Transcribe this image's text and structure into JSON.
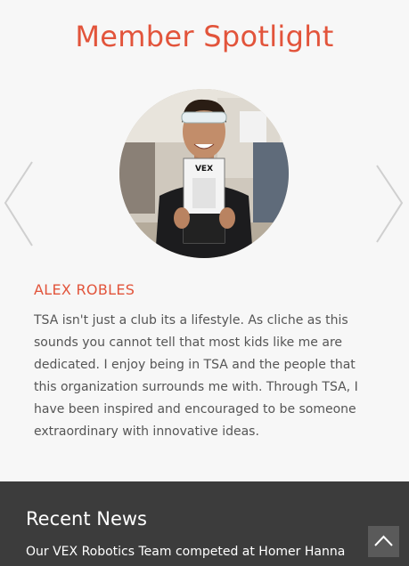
{
  "spotlight": {
    "title": "Member Spotlight",
    "photo_badge_text": "VEX",
    "member": {
      "name": "ALEX ROBLES",
      "quote": "TSA isn't just a club its a lifestyle. As cliche as this sounds you cannot tell that most kids like me are dedicated. I enjoy being in TSA and the people that this organization surrounds me with. Through TSA, I have been inspired and encouraged to be someone extraordinary with innovative ideas."
    },
    "prev_icon": "chevron-left-icon",
    "next_icon": "chevron-right-icon"
  },
  "news": {
    "title": "Recent News",
    "items": [
      {
        "text": "Our VEX Robotics Team competed at Homer Hanna"
      }
    ],
    "back_to_top_icon": "arrow-up-icon"
  },
  "colors": {
    "accent": "#e2543b",
    "news_background": "#3c3c3c",
    "page_background": "#f7f7f7"
  }
}
